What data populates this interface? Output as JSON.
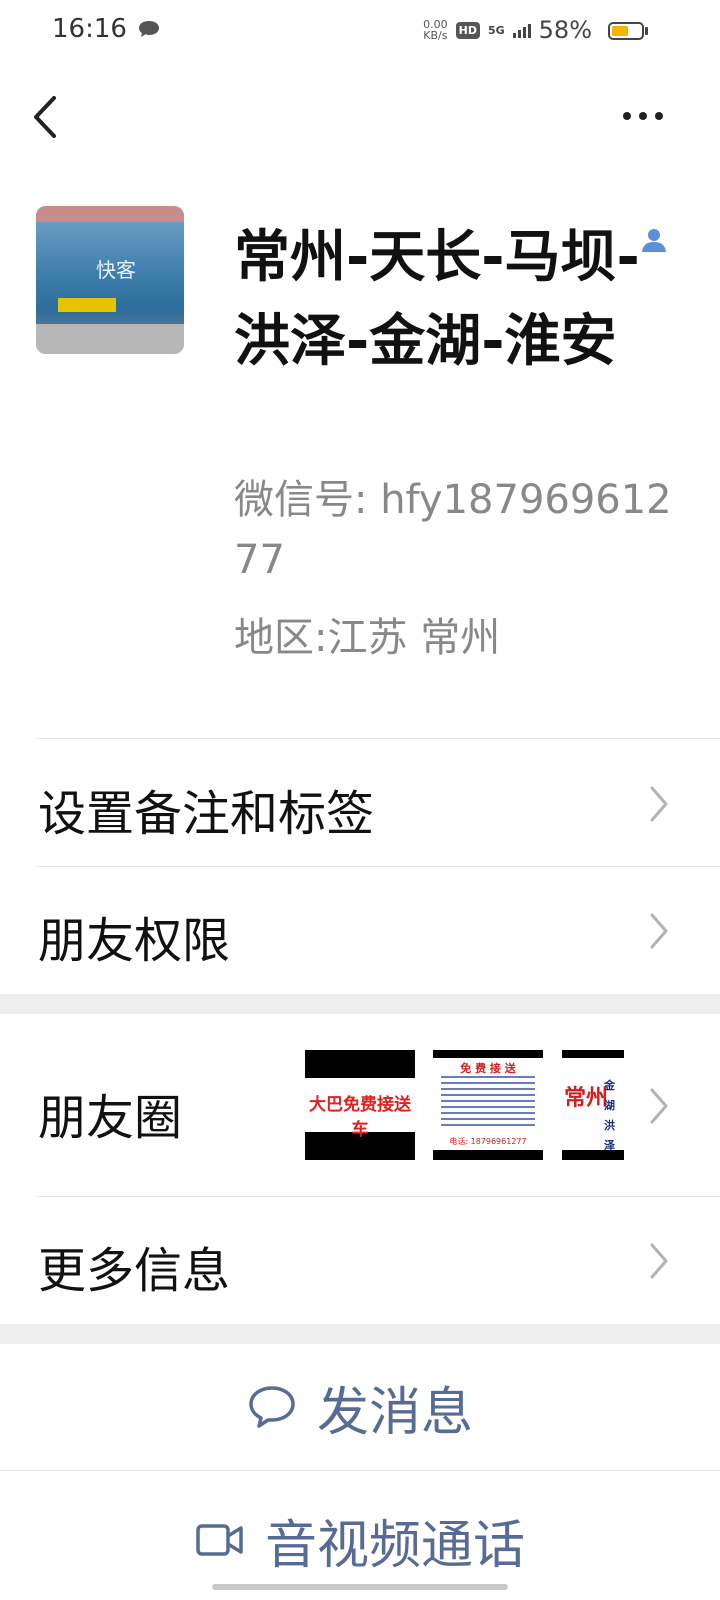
{
  "status_bar": {
    "time": "16:16",
    "net_speed_value": "0.00",
    "net_speed_unit": "KB/s",
    "hd": "HD",
    "signal": "5G",
    "battery": "58%",
    "battery_level": 0.58,
    "battery_color": "#f6b400"
  },
  "nav": {
    "back_icon": "chevron-left-icon",
    "more_icon": "more-dots-icon"
  },
  "profile": {
    "name": "常州-天长-马坝-洪泽-金湖-淮安",
    "wechat_id": "微信号: hfy18796961277",
    "region": "地区:江苏 常州",
    "avatar_brand": "快客"
  },
  "menu": {
    "remark": "设置备注和标签",
    "permissions": "朋友权限",
    "moments": "朋友圈",
    "more_info": "更多信息"
  },
  "moments_thumbs": {
    "thumb1_text": "大巴免费接送车",
    "thumb2_header": "免 费 接 送",
    "thumb2_phone": "电话: 18796961277",
    "thumb3_big": "常州",
    "thumb3_small": "金湖 洪泽 天长"
  },
  "actions": {
    "message": "发消息",
    "video_call": "音视频通话"
  },
  "colors": {
    "link_blue": "#576b95",
    "separator": "#ededed"
  }
}
